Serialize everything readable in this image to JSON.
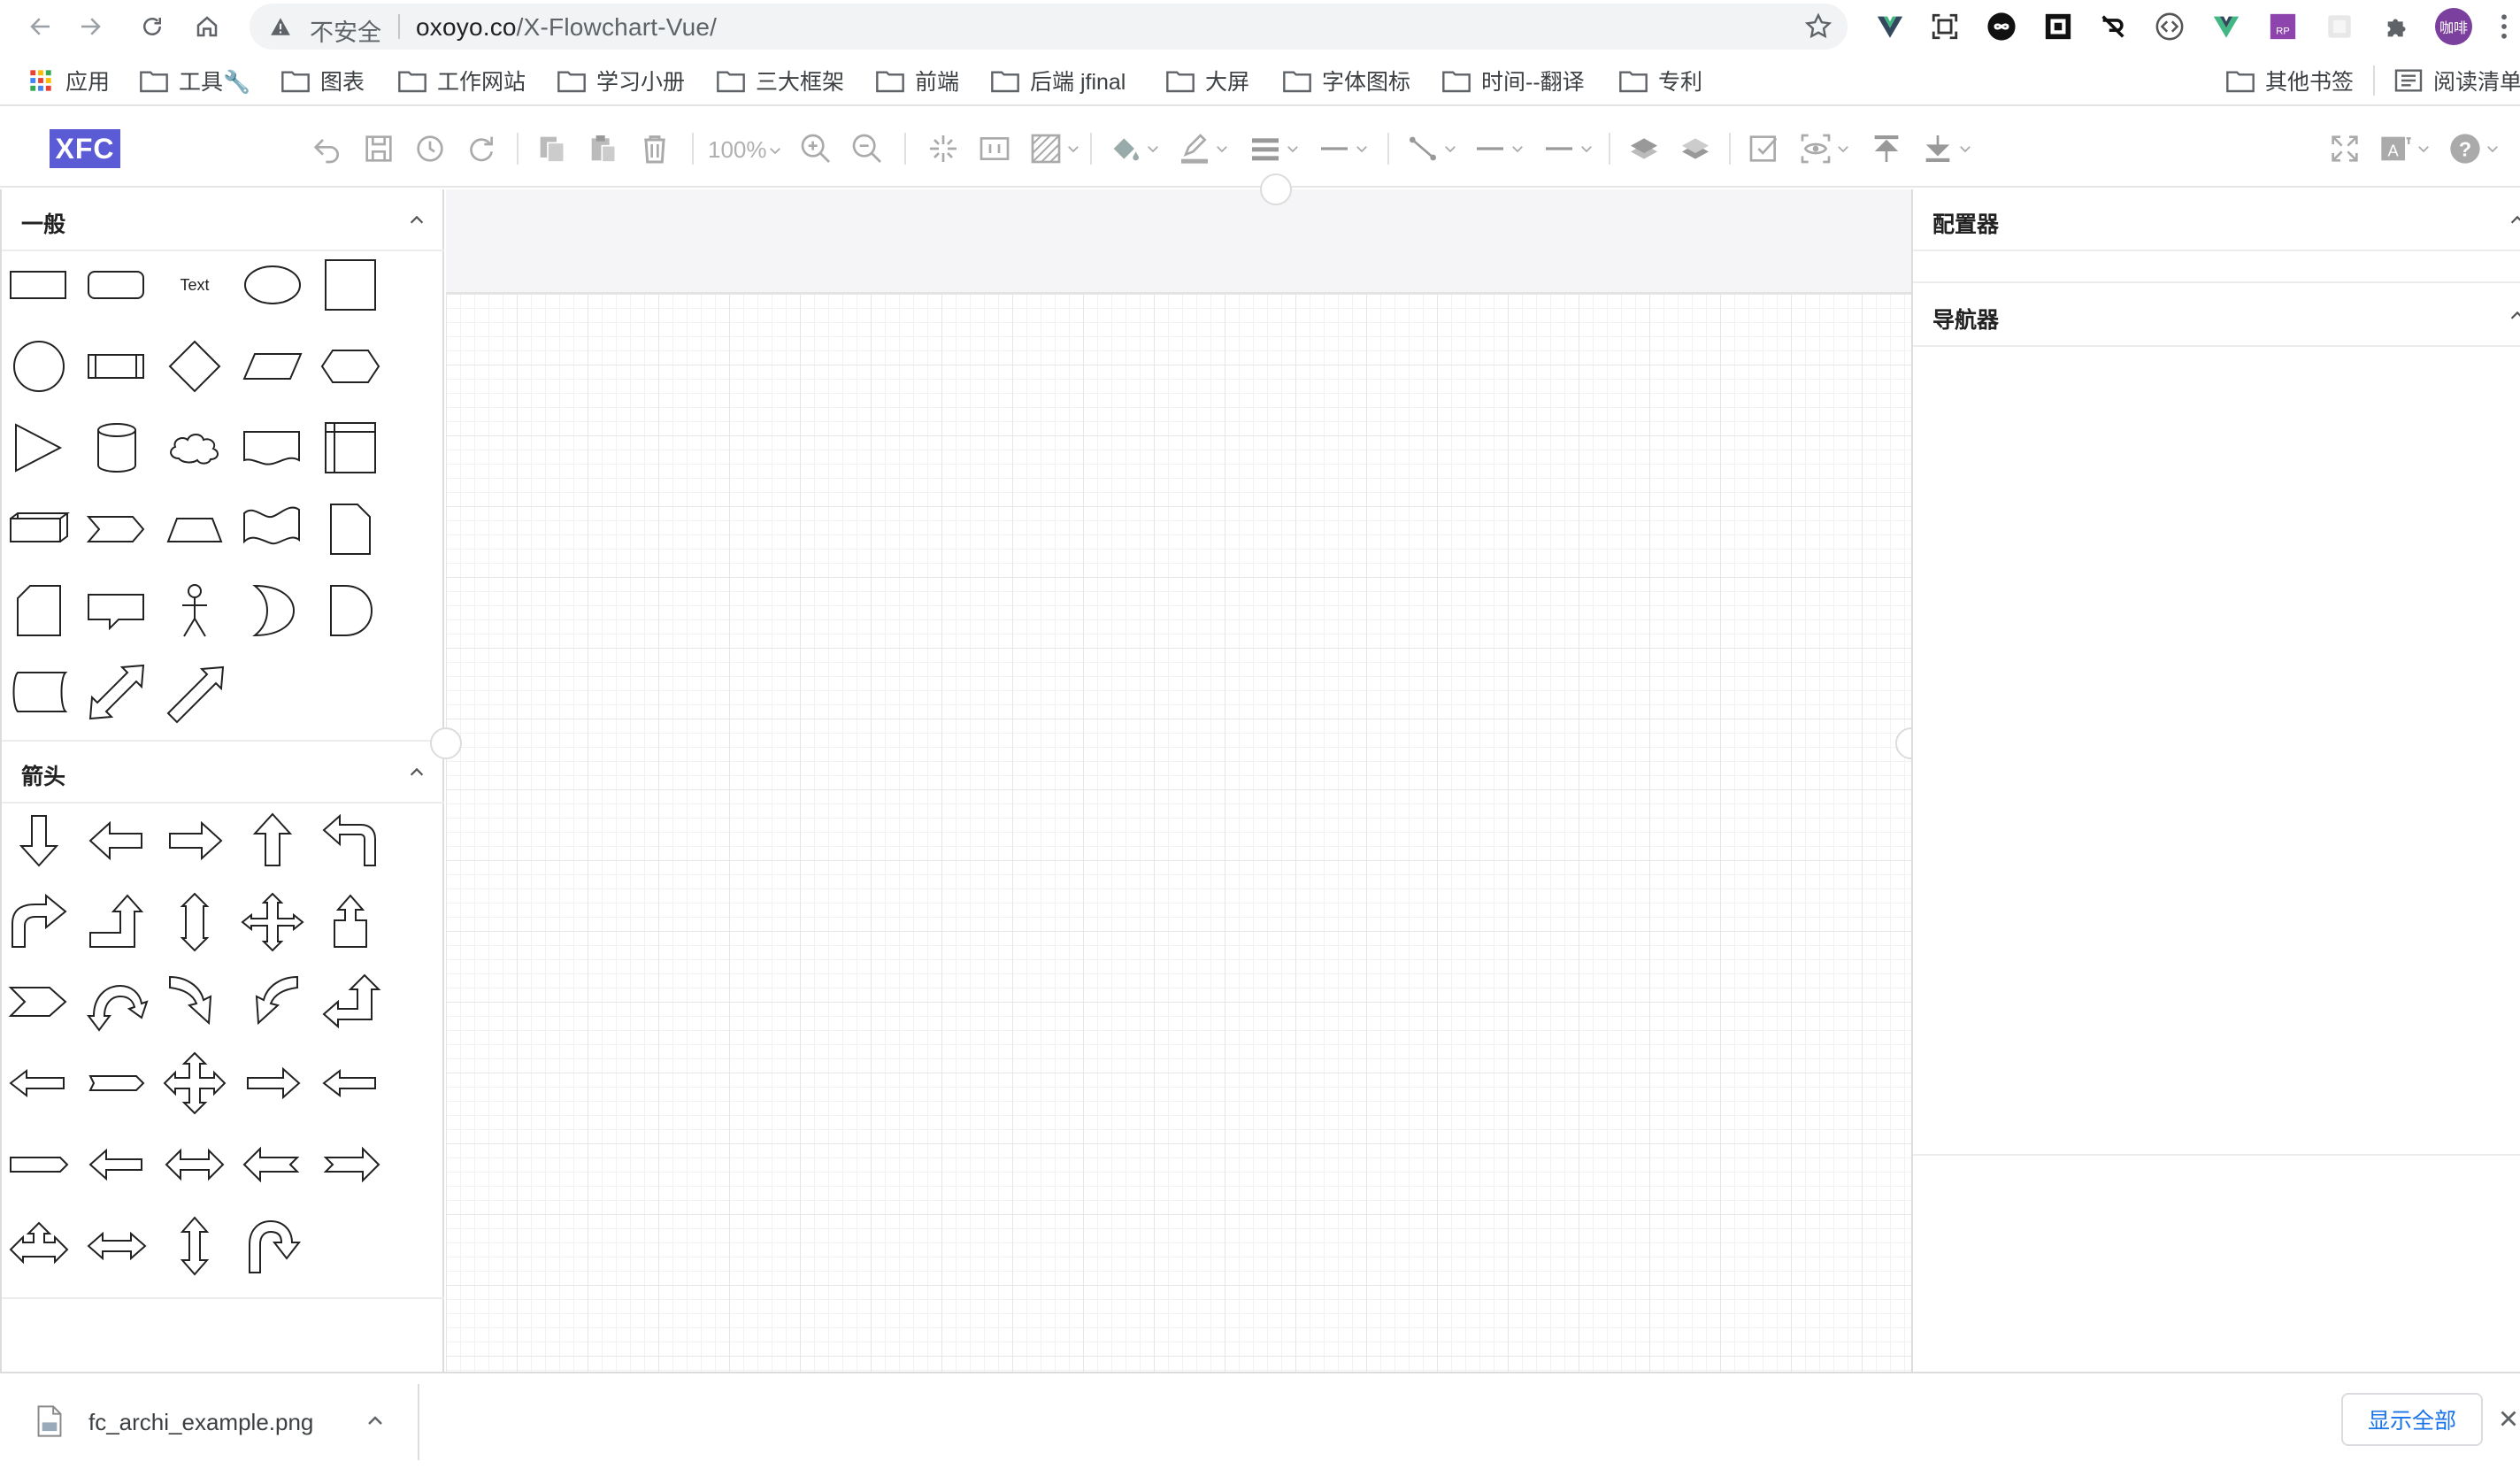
{
  "browser": {
    "security_label": "不安全",
    "url_host": "oxoyo.co",
    "url_path": "/X-Flowchart-Vue/",
    "profile_initials": "咖啡",
    "extensions": [
      "vue-devtools-icon",
      "screenshot-icon",
      "infinity-icon",
      "qr-icon",
      "crossed-icon",
      "code-icon",
      "vue-icon",
      "axure-rp-icon",
      "blank-extension-icon",
      "puzzle-icon"
    ]
  },
  "bookmarks": {
    "apps_label": "应用",
    "items": [
      {
        "label": "工具🔧"
      },
      {
        "label": "图表"
      },
      {
        "label": "工作网站"
      },
      {
        "label": "学习小册"
      },
      {
        "label": "三大框架"
      },
      {
        "label": "前端"
      },
      {
        "label": "后端 jfinal"
      },
      {
        "label": "大屏"
      },
      {
        "label": "字体图标"
      },
      {
        "label": "时间--翻译"
      },
      {
        "label": "专利"
      }
    ],
    "other_label": "其他书签",
    "reading_list_label": "阅读清单"
  },
  "app": {
    "logo": "XFC",
    "zoom": "100%",
    "toolbar_icons": [
      "undo-icon",
      "save-icon",
      "history-icon",
      "redo-icon",
      "copy-icon",
      "paste-icon",
      "delete-icon",
      "zoom-in-icon",
      "zoom-out-icon",
      "fit-icon",
      "actual-size-icon",
      "background-icon",
      "fill-color-icon",
      "line-color-icon",
      "line-width-icon",
      "line-style-icon",
      "connector-icon",
      "start-arrow-icon",
      "end-arrow-icon",
      "to-front-icon",
      "to-back-icon",
      "select-all-icon",
      "preview-icon",
      "upload-icon",
      "download-icon",
      "fullscreen-icon",
      "language-icon",
      "help-icon"
    ]
  },
  "left_panel": {
    "general_title": "一般",
    "arrows_title": "箭头",
    "text_shape_label": "Text",
    "general_shapes": [
      "rectangle",
      "rounded-rectangle",
      "text",
      "ellipse",
      "square",
      "circle",
      "process",
      "diamond",
      "parallelogram",
      "hexagon",
      "triangle",
      "cylinder",
      "cloud",
      "document",
      "internal-storage",
      "cube",
      "step",
      "trapezoid",
      "tape",
      "note",
      "card",
      "callout",
      "actor",
      "or",
      "and",
      "data-storage",
      "double-arrow",
      "single-arrow"
    ],
    "arrow_shapes": [
      "arrow-down",
      "arrow-left",
      "arrow-right",
      "arrow-up",
      "arrow-u-turn-left",
      "arrow-curve-right",
      "arrow-step-up",
      "arrow-up-down-hex",
      "arrow-four-way",
      "arrow-up-box",
      "chevron-arrow",
      "arrow-curved-down",
      "arrow-curve-down-right",
      "arrow-curve-down-left",
      "arrow-step-up-left",
      "arrow-left-flat",
      "arrow-pentagon",
      "arrow-cross-four",
      "arrow-right-small",
      "arrow-left-small",
      "arrow-pentagon-flat",
      "arrow-left-block",
      "arrow-left-right",
      "arrow-swallow-left",
      "arrow-swallow-right",
      "arrow-up-left-right",
      "arrow-left-right-thin",
      "arrow-up-down",
      "arrow-u-turn"
    ]
  },
  "right_panel": {
    "configurator_title": "配置器",
    "navigator_title": "导航器"
  },
  "download_bar": {
    "file_name": "fc_archi_example.png",
    "show_all_label": "显示全部"
  }
}
